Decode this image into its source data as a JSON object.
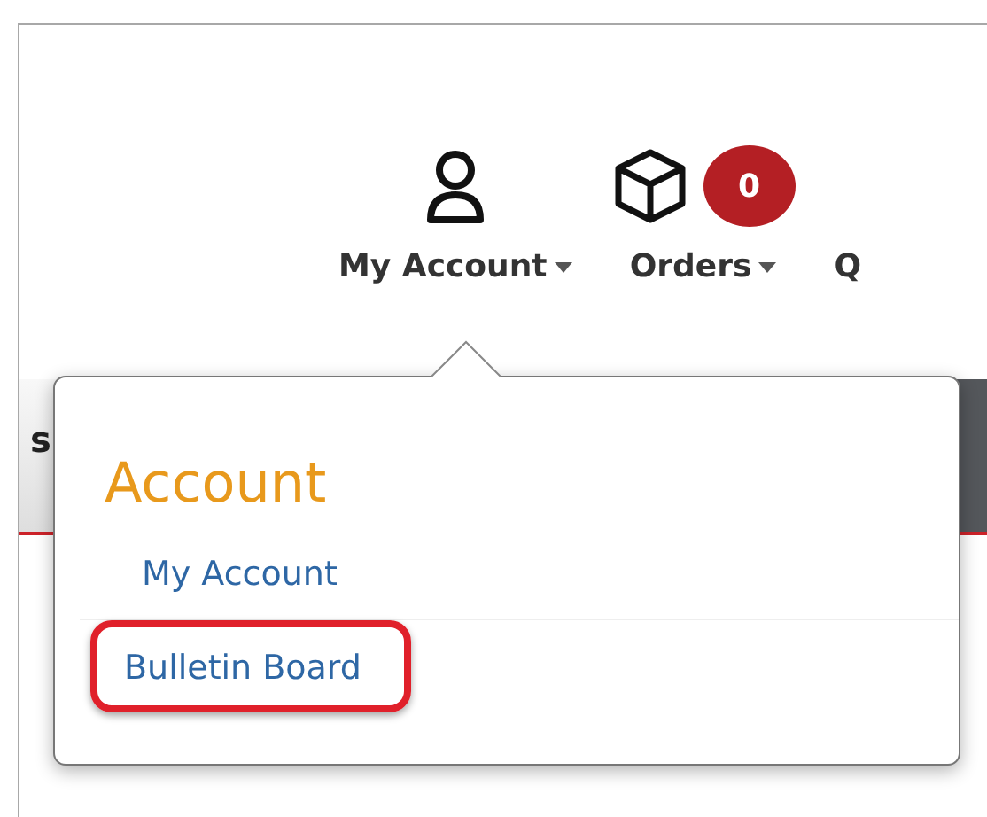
{
  "header": {
    "items": [
      {
        "kind": "account",
        "label": "My Account"
      },
      {
        "kind": "orders",
        "label": "Orders",
        "badge": "0"
      },
      {
        "kind": "cut",
        "label": "Q"
      }
    ]
  },
  "nav_bar": {
    "cut_text": "s"
  },
  "dropdown": {
    "heading": "Account",
    "items": [
      {
        "label": "My Account",
        "highlighted": false
      },
      {
        "label": "Bulletin Board",
        "highlighted": true
      }
    ]
  }
}
